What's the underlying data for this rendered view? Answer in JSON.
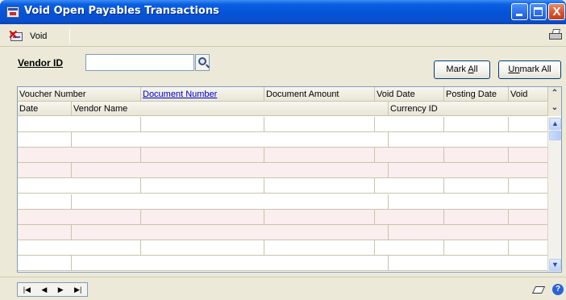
{
  "window": {
    "title": "Void Open Payables Transactions",
    "close_glyph": "X"
  },
  "toolbar": {
    "void_label": "Void",
    "icons": [
      "void-icon",
      "print-icon"
    ]
  },
  "vendor": {
    "label": "Vendor ID",
    "value": "",
    "placeholder": ""
  },
  "buttons": {
    "mark_all_pre": "Mark ",
    "mark_all_accel": "A",
    "mark_all_post": "ll",
    "unmark_all_pre": "U",
    "unmark_all_accel": "n",
    "unmark_all_post": "mark All"
  },
  "grid": {
    "header_row1": [
      "Voucher Number",
      "Document Number",
      "Document Amount",
      "Void Date",
      "Posting Date",
      "Void"
    ],
    "header_row2": [
      "Date",
      "Vendor Name",
      "Currency ID"
    ],
    "row_count": 10,
    "expand_up_glyph": "⌃",
    "expand_down_glyph": "⌄"
  },
  "nav": {
    "first": "|◀",
    "prev": "◀",
    "next": "▶",
    "last": "▶|"
  },
  "help": "?",
  "colors": {
    "title_bar": "#0553d6",
    "alt_row": "#fbeeee",
    "link": "#0000cc",
    "window_bg": "#ece9d8"
  }
}
